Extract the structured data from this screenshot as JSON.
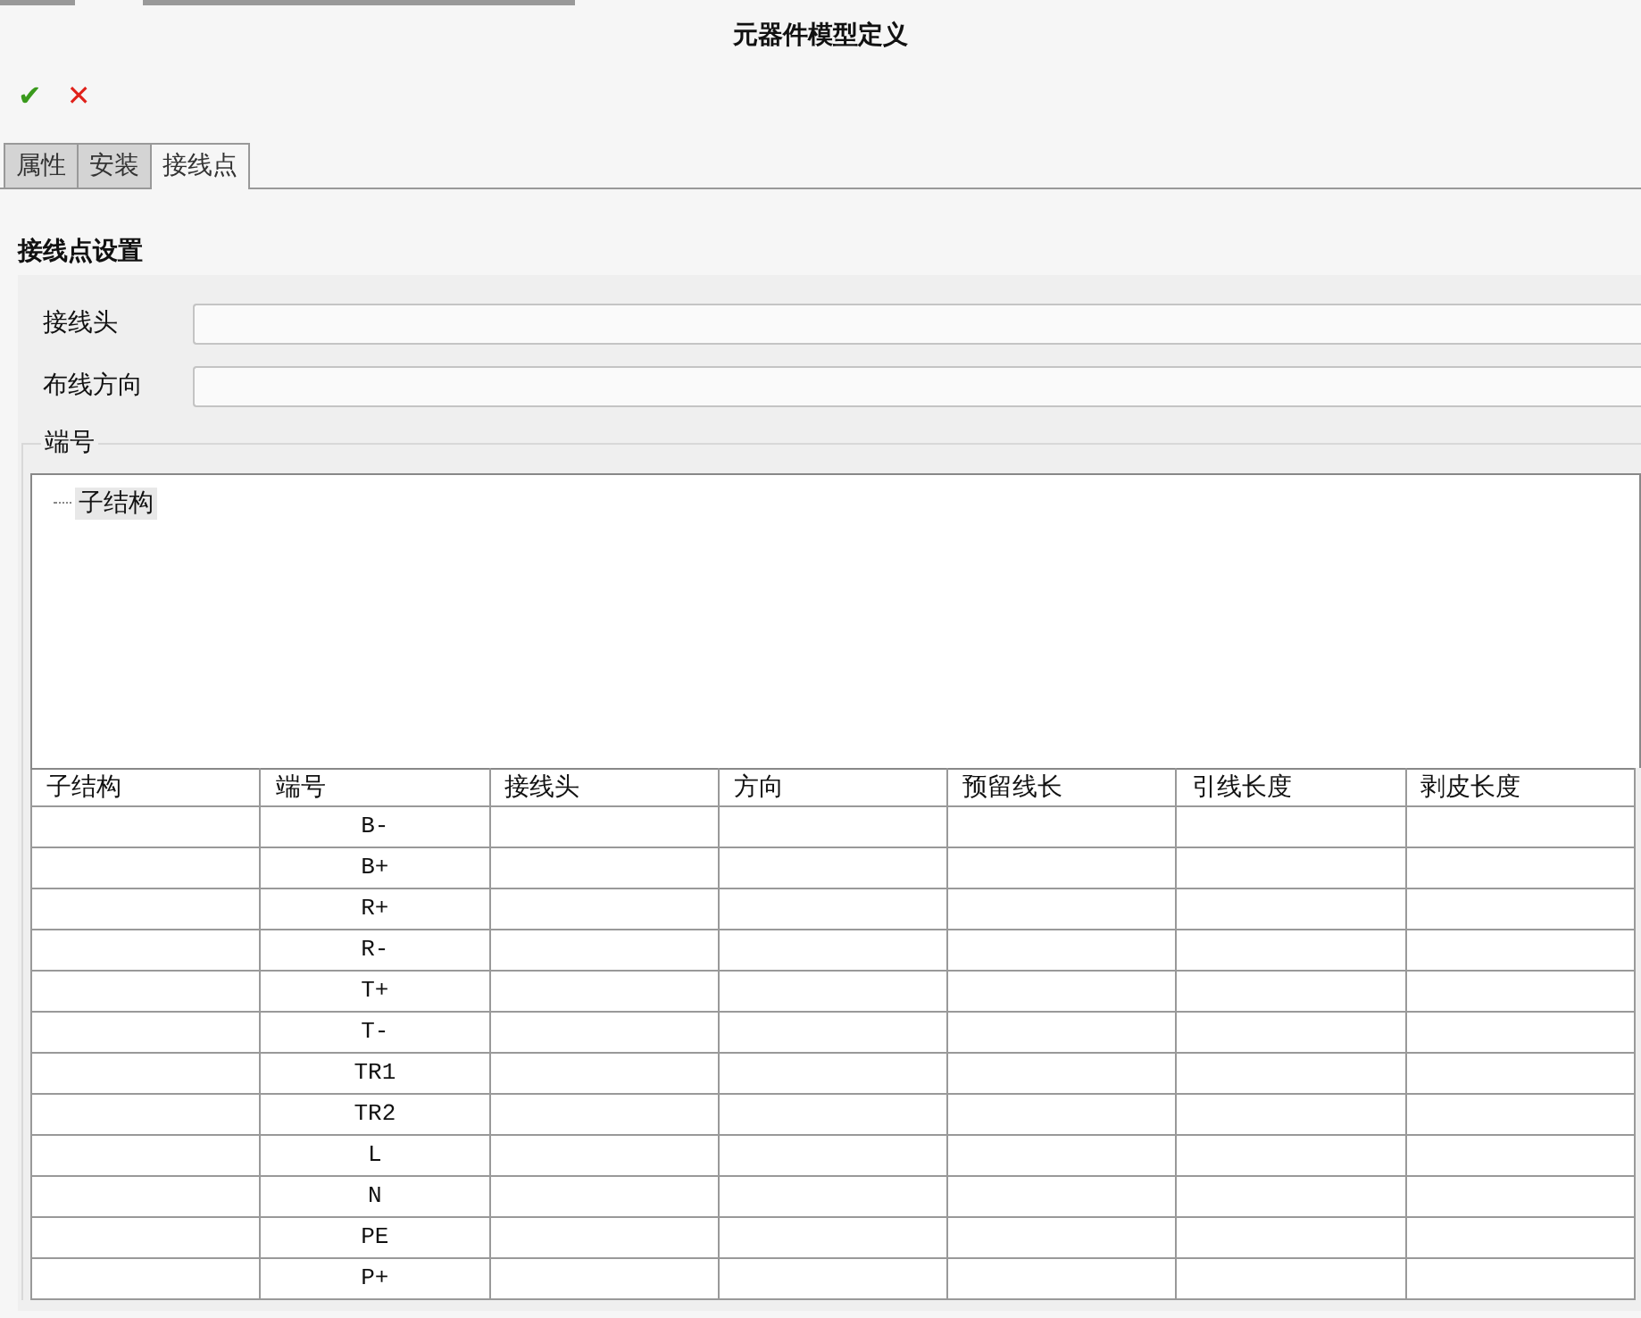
{
  "window": {
    "title": "元器件模型定义"
  },
  "toolbar": [
    {
      "kind": "confirm",
      "label": "✔"
    },
    {
      "kind": "cancel",
      "label": "✕"
    }
  ],
  "tabs": [
    {
      "label": "属性",
      "selected": false
    },
    {
      "label": "安装",
      "selected": false
    },
    {
      "label": "接线点",
      "selected": true
    }
  ],
  "section_title": "接线点设置",
  "fields": [
    {
      "label": "接线头"
    },
    {
      "label": "布线方向"
    }
  ],
  "group": {
    "title": "端号",
    "tree": [
      {
        "label": "子结构"
      }
    ]
  },
  "table": {
    "columns": [
      "子结构",
      "端号",
      "接线头",
      "方向",
      "预留线长",
      "引线长度",
      "剥皮长度"
    ],
    "rows": [
      {
        "terminal": "B-"
      },
      {
        "terminal": "B+"
      },
      {
        "terminal": "R+"
      },
      {
        "terminal": "R-"
      },
      {
        "terminal": "T+"
      },
      {
        "terminal": "T-"
      },
      {
        "terminal": "TR1"
      },
      {
        "terminal": "TR2"
      },
      {
        "terminal": "L"
      },
      {
        "terminal": "N"
      },
      {
        "terminal": "PE"
      },
      {
        "terminal": "P+"
      }
    ]
  }
}
